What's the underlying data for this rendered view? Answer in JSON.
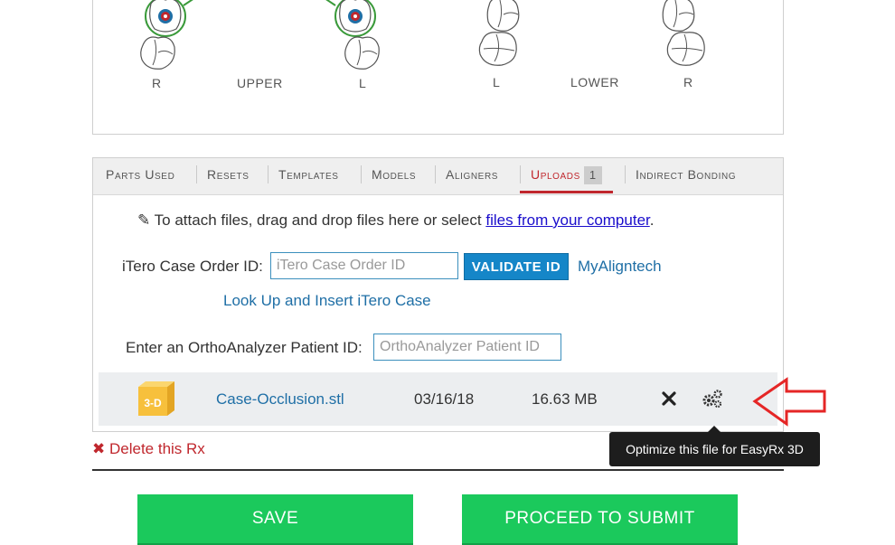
{
  "tooth_chart": {
    "labels": {
      "upper_right": "R",
      "upper_title": "UPPER",
      "upper_left": "L",
      "lower_left": "L",
      "lower_title": "LOWER",
      "lower_right": "R"
    }
  },
  "tabs": [
    {
      "label": "Parts Used",
      "active": false
    },
    {
      "label": "Resets",
      "active": false
    },
    {
      "label": "Templates",
      "active": false
    },
    {
      "label": "Models",
      "active": false
    },
    {
      "label": "Aligners",
      "active": false
    },
    {
      "label": "Uploads",
      "active": true,
      "badge": "1"
    },
    {
      "label": "Indirect Bonding",
      "active": false
    }
  ],
  "uploads": {
    "attach_text": "To attach files, drag and drop files here or select",
    "attach_link": "files from your computer",
    "attach_suffix": ".",
    "itero": {
      "label": "iTero Case Order ID:",
      "placeholder": "iTero Case Order ID",
      "validate_label": "VALIDATE ID",
      "myaligntech_label": "MyAligntech",
      "lookup_label": "Look Up and Insert iTero Case"
    },
    "ortho": {
      "label": "Enter an OrthoAnalyzer Patient ID:",
      "placeholder": "OrthoAnalyzer Patient ID"
    },
    "file": {
      "icon_text": "3-D",
      "name": "Case-Occlusion.stl",
      "date": "03/16/18",
      "size": "16.63 MB"
    },
    "tooltip": "Optimize this file for EasyRx 3D"
  },
  "delete_label": "Delete this Rx",
  "buttons": {
    "save": "SAVE",
    "proceed": "PROCEED TO SUBMIT"
  },
  "colors": {
    "accent_red": "#c0272d",
    "link_blue": "#1f6fa6",
    "validate_blue": "#1586c8",
    "green": "#1bc95c",
    "tooth_green": "#3a9a3a"
  }
}
